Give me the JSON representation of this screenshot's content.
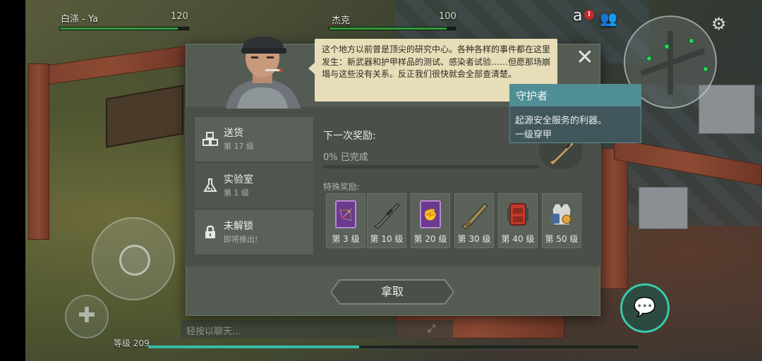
{
  "hud": {
    "player1": {
      "name": "白涤 - Ya",
      "hp": "120",
      "hp_fraction": 0.92
    },
    "player2": {
      "name": "杰克",
      "hp": "100",
      "hp_fraction": 0.93
    },
    "alert_badge": "!",
    "level_text": "等级 209",
    "xp_fraction": 0.43,
    "chat_placeholder": "轻按以聊天..."
  },
  "dialog": {
    "speech": "这个地方以前曾是顶尖的研究中心。各种各样的事件都在这里发生：新武器和护甲样品的测试、感染者试验……但愿那场崩塌与这些没有关系。反正我们很快就会全部查清楚。",
    "close_label": "✕",
    "tabs": [
      {
        "label": "送货",
        "sub": "第 17 级",
        "icon": "boxes-icon"
      },
      {
        "label": "实验室",
        "sub": "第 1 级",
        "icon": "flask-icon"
      },
      {
        "label": "未解锁",
        "sub": "即将推出!",
        "icon": "lock-icon"
      }
    ],
    "next_reward_label": "下一次奖励:",
    "progress_text": "0% 已完成",
    "progress_fraction": 0,
    "special_reward_label": "特殊奖励:",
    "rewards": [
      {
        "level": "第 3 级",
        "icon": "purple-card-icon"
      },
      {
        "level": "第 10 级",
        "icon": "sniper-rifle-icon"
      },
      {
        "level": "第 20 级",
        "icon": "purple-card-icon"
      },
      {
        "level": "第 30 级",
        "icon": "shotgun-icon"
      },
      {
        "level": "第 40 级",
        "icon": "red-backpack-icon"
      },
      {
        "level": "第 50 级",
        "icon": "armor-vest-icon"
      }
    ],
    "take_button": "拿取"
  },
  "tooltip": {
    "title": "守护者",
    "line1": "起源安全服务的利器。",
    "line2": "一级穿甲"
  },
  "colors": {
    "accent": "#39b9a8",
    "hp_green": "#2fa040",
    "tooltip_header": "#4e8e94",
    "card_purple": "#6c3a8e"
  }
}
